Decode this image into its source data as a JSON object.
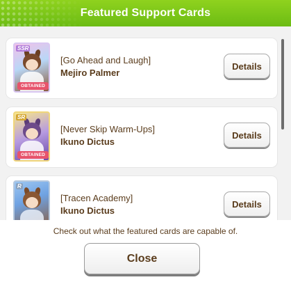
{
  "header": {
    "title": "Featured Support Cards"
  },
  "cards": [
    {
      "rarity": "SSR",
      "obtained_label": "OBTAINED",
      "title": "[Go Ahead and Laugh]",
      "name": "Mejiro Palmer",
      "button_label": "Details"
    },
    {
      "rarity": "SR",
      "obtained_label": "OBTAINED",
      "title": "[Never Skip Warm-Ups]",
      "name": "Ikuno Dictus",
      "button_label": "Details"
    },
    {
      "rarity": "R",
      "obtained_label": "",
      "title": "[Tracen Academy]",
      "name": "Ikuno Dictus",
      "button_label": "Details"
    }
  ],
  "footer": {
    "info_text": "Check out what the featured cards are capable of.",
    "close_label": "Close"
  },
  "colors": {
    "header_green": "#7cc81a",
    "text_brown": "#5a3c1c",
    "obtained_pink": "#e7546c"
  }
}
